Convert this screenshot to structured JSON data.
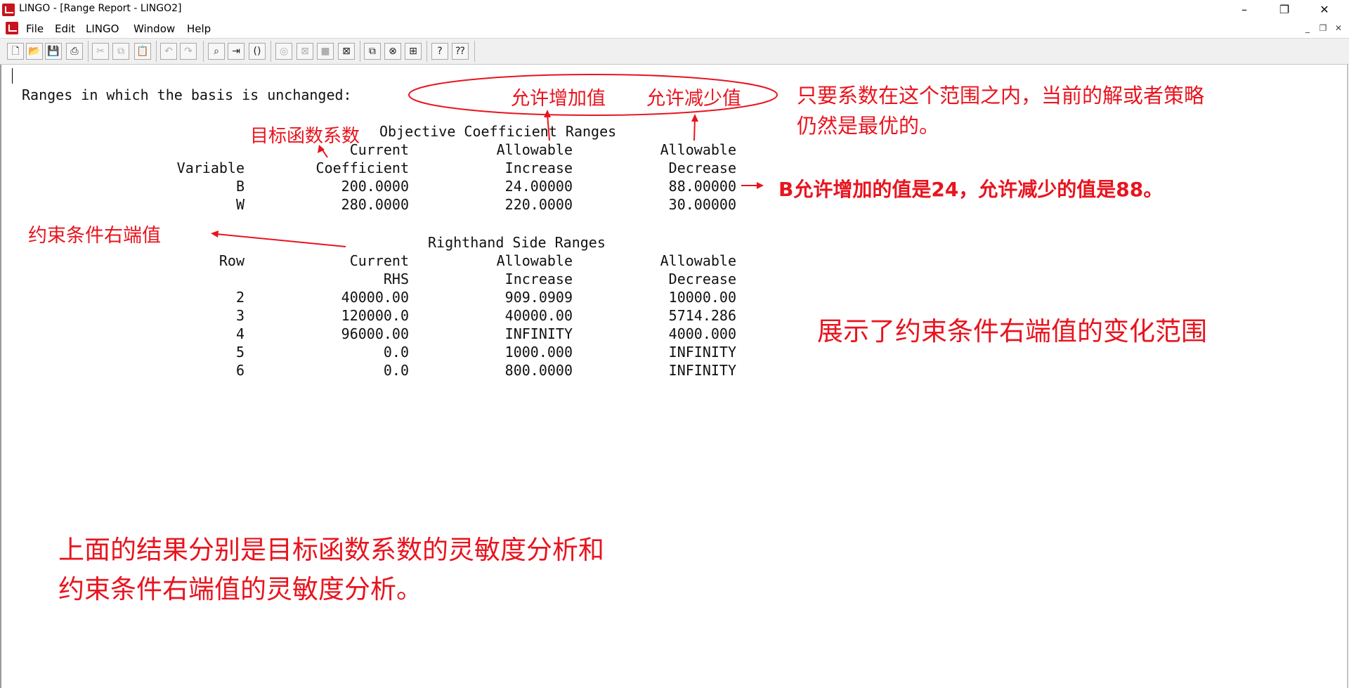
{
  "window": {
    "title": "LINGO - [Range Report - LINGO2]",
    "controls": {
      "minimize": "–",
      "restore": "❐",
      "close": "✕"
    }
  },
  "menu": {
    "items": [
      "File",
      "Edit",
      "LINGO",
      "Window",
      "Help"
    ],
    "mdi_controls": {
      "minimize": "_",
      "restore": "❐",
      "close": "✕"
    }
  },
  "toolbar": {
    "buttons": [
      {
        "name": "new-file-icon",
        "glyph": "🗋"
      },
      {
        "name": "open-file-icon",
        "glyph": "📂"
      },
      {
        "name": "save-icon",
        "glyph": "💾"
      },
      {
        "name": "print-icon",
        "glyph": "⎙"
      },
      {
        "name": "cut-icon",
        "glyph": "✂"
      },
      {
        "name": "copy-icon",
        "glyph": "⧉"
      },
      {
        "name": "paste-icon",
        "glyph": "📋"
      },
      {
        "name": "undo-icon",
        "glyph": "↶"
      },
      {
        "name": "redo-icon",
        "glyph": "↷"
      },
      {
        "name": "find-icon",
        "glyph": "⌕"
      },
      {
        "name": "goto-line-icon",
        "glyph": "⇥"
      },
      {
        "name": "match-parenthesis-icon",
        "glyph": "()"
      },
      {
        "name": "solve-icon",
        "glyph": "◎"
      },
      {
        "name": "solution-icon",
        "glyph": "⊠"
      },
      {
        "name": "matrix-picture-icon",
        "glyph": "■"
      },
      {
        "name": "options-icon",
        "glyph": "⊠"
      },
      {
        "name": "send-to-back-icon",
        "glyph": "⧉"
      },
      {
        "name": "close-all-icon",
        "glyph": "⊗"
      },
      {
        "name": "tile-icon",
        "glyph": "⊞"
      },
      {
        "name": "help-icon",
        "glyph": "?"
      },
      {
        "name": "context-help-icon",
        "glyph": "⁇"
      }
    ]
  },
  "report": {
    "header": "Ranges in which the basis is unchanged:",
    "objective": {
      "title": "Objective Coefficient Ranges",
      "col_head1": [
        "",
        "Current",
        "Allowable",
        "Allowable"
      ],
      "col_head2": [
        "Variable",
        "Coefficient",
        "Increase",
        "Decrease"
      ],
      "rows": [
        [
          "B",
          "200.0000",
          "24.00000",
          "88.00000"
        ],
        [
          "W",
          "280.0000",
          "220.0000",
          "30.00000"
        ]
      ]
    },
    "rhs": {
      "title": "Righthand Side Ranges",
      "col_head1": [
        "Row",
        "Current",
        "Allowable",
        "Allowable"
      ],
      "col_head2": [
        "",
        "RHS",
        "Increase",
        "Decrease"
      ],
      "rows": [
        [
          "2",
          "40000.00",
          "909.0909",
          "10000.00"
        ],
        [
          "3",
          "120000.0",
          "40000.00",
          "5714.286"
        ],
        [
          "4",
          "96000.00",
          "INFINITY",
          "4000.000"
        ],
        [
          "5",
          "0.0",
          "1000.000",
          "INFINITY"
        ],
        [
          "6",
          "0.0",
          "800.0000",
          "INFINITY"
        ]
      ]
    }
  },
  "annotations": {
    "allow_increase": "允许增加值",
    "allow_decrease": "允许减少值",
    "optimal_range_line1": "只要系数在这个范围之内，当前的解或者策略",
    "optimal_range_line2": "仍然是最优的。",
    "objective_coef": "目标函数系数",
    "b_note": "B允许增加的值是24，允许减少的值是88。",
    "rhs_value": "约束条件右端值",
    "rhs_range": "展示了约束条件右端值的变化范围",
    "summary_line1": "上面的结果分别是目标函数系数的灵敏度分析和",
    "summary_line2": "约束条件右端值的灵敏度分析。"
  },
  "colors": {
    "annotation": "#e8141e",
    "app_icon": "#c8141e",
    "toolbar": "#f0f0f0"
  }
}
